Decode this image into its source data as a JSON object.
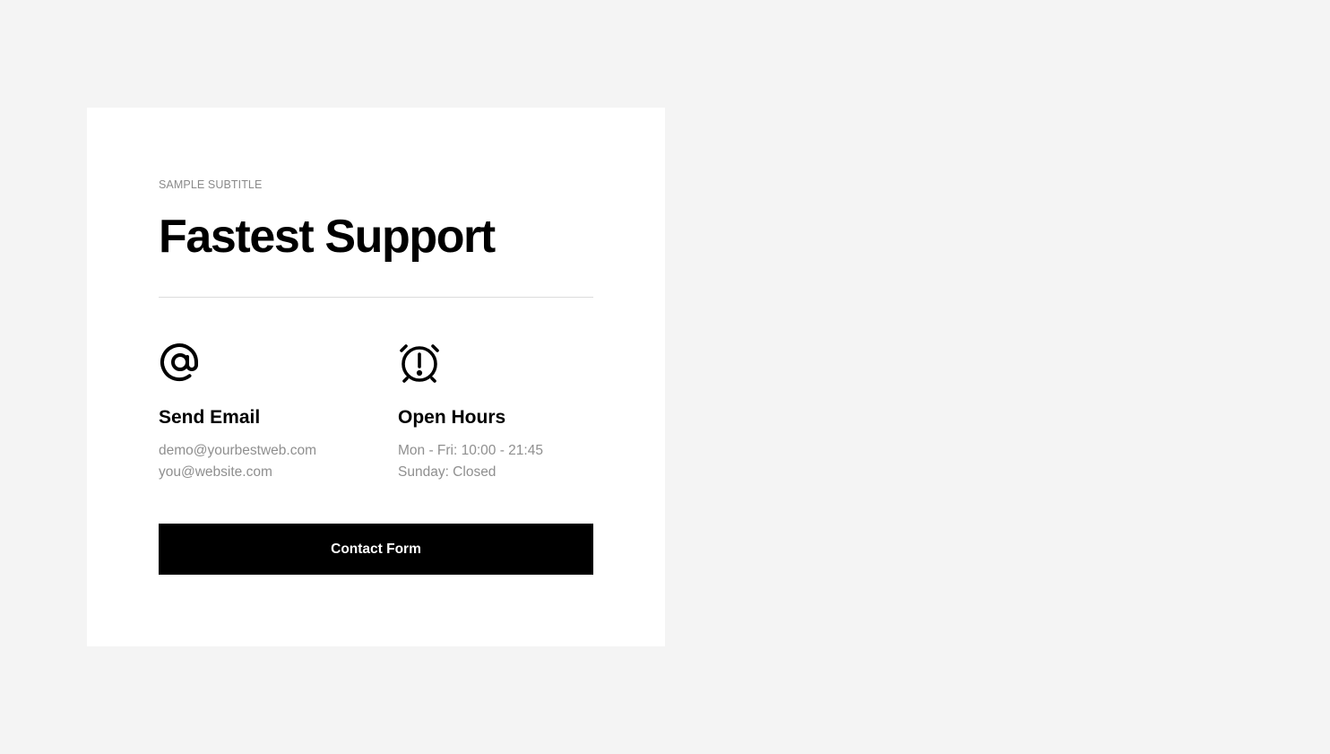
{
  "card": {
    "subtitle": "SAMPLE SUBTITLE",
    "title": "Fastest Support"
  },
  "email": {
    "icon": "at-icon",
    "heading": "Send Email",
    "lines": [
      "demo@yourbestweb.com",
      "you@website.com"
    ]
  },
  "hours": {
    "icon": "alarm-clock-alert-icon",
    "heading": "Open Hours",
    "lines": [
      "Mon - Fri: 10:00 - 21:45",
      "Sunday: Closed"
    ]
  },
  "button": {
    "label": "Contact Form"
  },
  "colors": {
    "page_background": "#f4f4f4",
    "card_background": "#ffffff",
    "text_primary": "#000000",
    "text_muted": "#8f8f8f",
    "button_background": "#000000",
    "button_text": "#ffffff"
  }
}
